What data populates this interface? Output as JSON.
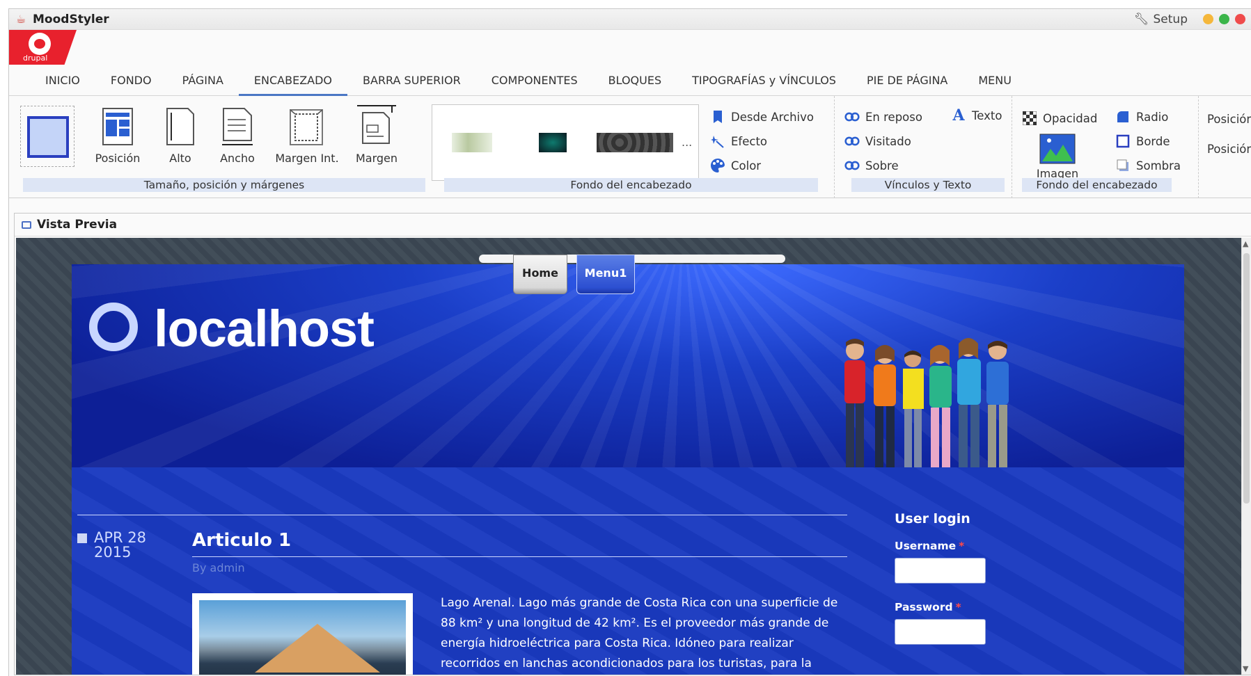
{
  "window": {
    "title": "MoodStyler",
    "setup_label": "Setup",
    "lights": [
      "#f5b73b",
      "#3bb54a",
      "#ef4b4b"
    ]
  },
  "logo": {
    "text": "drupal"
  },
  "tabs": [
    {
      "label": "INICIO"
    },
    {
      "label": "FONDO"
    },
    {
      "label": "PÁGINA"
    },
    {
      "label": "ENCABEZADO",
      "active": true
    },
    {
      "label": "BARRA SUPERIOR"
    },
    {
      "label": "COMPONENTES"
    },
    {
      "label": "BLOQUES"
    },
    {
      "label": "TIPOGRAFÍAS y VÍNCULOS"
    },
    {
      "label": "PIE DE PÁGINA"
    },
    {
      "label": "MENU"
    }
  ],
  "ribbon": {
    "size_group": {
      "label": "Tamaño, posición y márgenes",
      "buttons": [
        "Posición",
        "Alto",
        "Ancho",
        "Margen Int.",
        "Margen"
      ]
    },
    "bg_group": {
      "label": "Fondo del encabezado",
      "more": "...",
      "from_file": "Desde Archivo",
      "effect": "Efecto",
      "color": "Color"
    },
    "links_group": {
      "label": "Vínculos y Texto",
      "normal": "En reposo",
      "visited": "Visitado",
      "hover": "Sobre",
      "text": "Texto"
    },
    "bg2_group": {
      "label": "Fondo del encabezado",
      "opacity": "Opacidad",
      "image": "Imagen",
      "radius": "Radio",
      "border": "Borde",
      "shadow": "Sombra"
    },
    "position_group": {
      "pos1": "Posición",
      "pos2": "Posición"
    },
    "accent": "#2a3fbf"
  },
  "preview": {
    "title": "Vista Previa",
    "nav": {
      "home": "Home",
      "menu1": "Menu1"
    },
    "site_name": "localhost",
    "article": {
      "month_day": "APR 28",
      "year": "2015",
      "title": "Articulo 1",
      "byline": "By admin",
      "text": "Lago Arenal. Lago más grande de Costa Rica con una superficie de 88 km² y una longitud de 42 km². Es el proveedor más grande de energía hidroeléctrica para Costa Rica. Idóneo para realizar recorridos en lanchas acondicionados para los turistas, para la pesca"
    },
    "login": {
      "title": "User login",
      "username_label": "Username",
      "password_label": "Password",
      "required_mark": "*"
    },
    "colors": {
      "header": "#1b3fc8",
      "body": "#1a3ac0",
      "background": "#3c4854"
    }
  }
}
